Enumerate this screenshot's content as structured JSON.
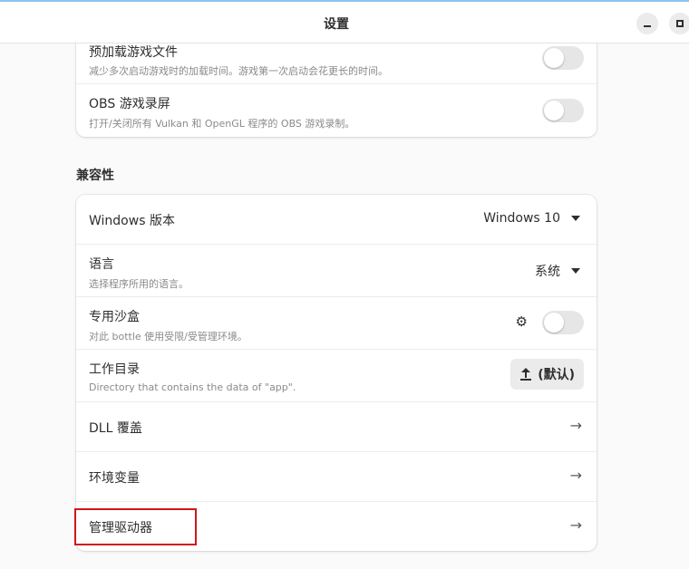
{
  "header": {
    "title": "设置"
  },
  "top_card": {
    "preload": {
      "title": "预加载游戏文件",
      "subtitle": "减少多次启动游戏时的加载时间。游戏第一次启动会花更长的时间。",
      "enabled": false
    },
    "obs": {
      "title": "OBS 游戏录屏",
      "subtitle": "打开/关闭所有 Vulkan 和 OpenGL 程序的 OBS 游戏录制。",
      "enabled": false
    }
  },
  "compat": {
    "section_title": "兼容性",
    "windows_version": {
      "title": "Windows 版本",
      "value": "Windows 10"
    },
    "language": {
      "title": "语言",
      "subtitle": "选择程序所用的语言。",
      "value": "系统"
    },
    "sandbox": {
      "title": "专用沙盒",
      "subtitle": "对此 bottle 使用受限/受管理环境。",
      "enabled": false
    },
    "workdir": {
      "title": "工作目录",
      "subtitle": "Directory that contains the data of \"app\".",
      "button_label": "(默认)"
    },
    "dll_overrides": {
      "title": "DLL 覆盖"
    },
    "env_vars": {
      "title": "环境变量"
    },
    "manage_drivers": {
      "title": "管理驱动器"
    }
  },
  "icons": {
    "upload": "upload-icon",
    "gear": "gear-icon",
    "arrow": "arrow-right-icon",
    "caret": "caret-down-icon"
  },
  "colors": {
    "highlight": "#d0161a",
    "top_accent": "#8fc3ef"
  }
}
